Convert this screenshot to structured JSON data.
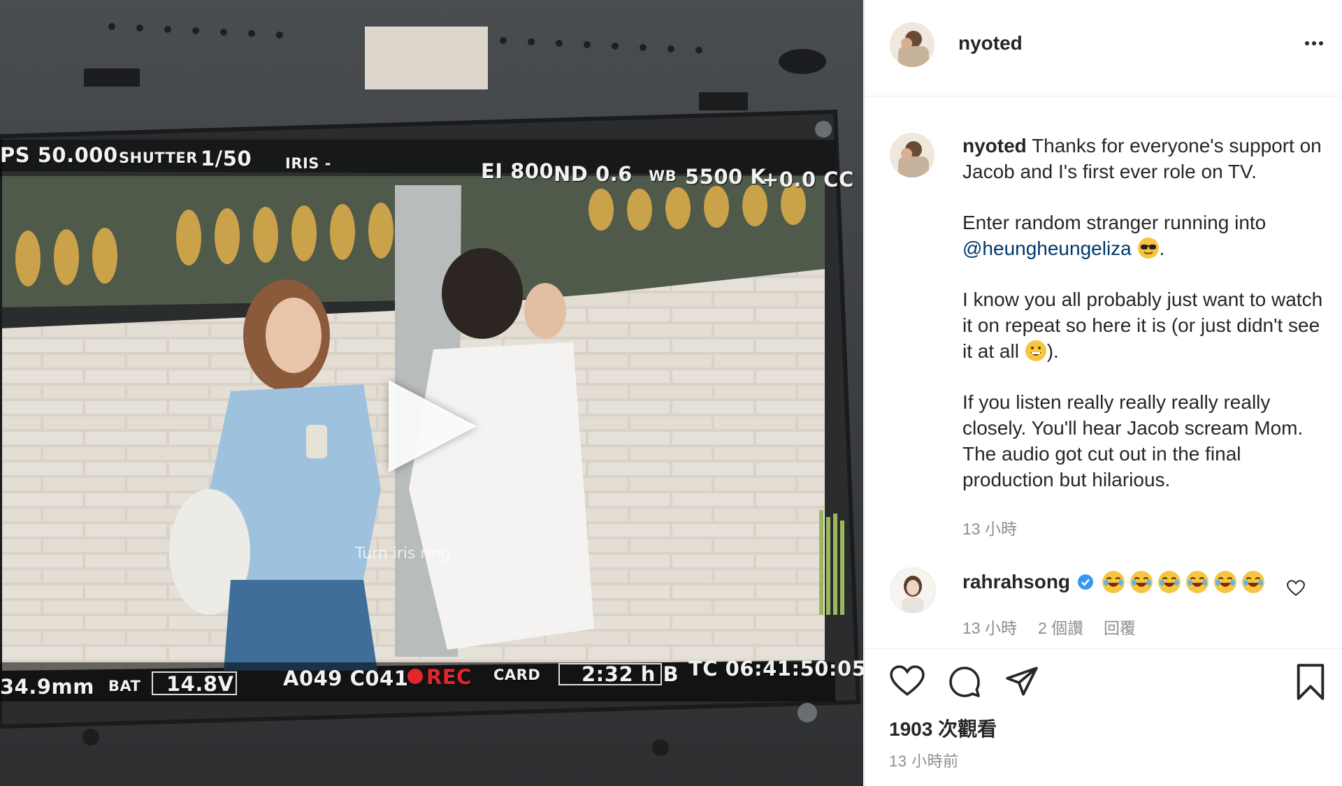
{
  "post": {
    "username": "nyoted",
    "caption_paragraphs": [
      "Thanks for everyone's support on Jacob and I's first ever role on TV.",
      "Enter random stranger running into",
      "I know you all probably just want to watch it on repeat so here it is (or just didn't see it at all",
      "If you listen really really really really closely. You'll hear Jacob scream Mom. The audio got cut out in the final production but hilarious."
    ],
    "mention": "@heungheungeliza",
    "caption_time": "13 小時",
    "views": "1903 次觀看",
    "posted_time": "13 小時前"
  },
  "comment": {
    "username": "rahrahsong",
    "emojis": [
      "face-with-tears-of-joy",
      "face-with-tears-of-joy",
      "face-with-tears-of-joy",
      "face-with-tears-of-joy",
      "face-with-tears-of-joy",
      "face-with-tears-of-joy"
    ],
    "time": "13 小時",
    "likes": "2 個讚",
    "reply": "回覆"
  },
  "video": {
    "osd": {
      "fps": "PS 50.000",
      "shutter_label": "SHUTTER",
      "shutter": "1/50",
      "iris": "IRIS -",
      "ei": "EI 800",
      "nd": "ND 0.6",
      "wb_label": "WB",
      "wb": "5500 K",
      "cc": "+0.0 CC",
      "lens": "34.9mm",
      "bat_label": "BAT",
      "bat": "14.8V",
      "clip": "A049 C041",
      "rec": "REC",
      "card_label": "CARD",
      "card": "2:32 h B",
      "tc": "TC 06:41:50:05",
      "subtitle": "Turn iris ring"
    }
  },
  "icons": {
    "more": "more-horizontal-icon",
    "like": "heart-icon",
    "comment": "comment-bubble-icon",
    "share": "paper-plane-icon",
    "save": "bookmark-icon",
    "verified": "verified-badge-icon",
    "play": "play-icon"
  },
  "colors": {
    "mention": "#00376b",
    "verified": "#3897f0",
    "muted": "#8e8e8e"
  }
}
